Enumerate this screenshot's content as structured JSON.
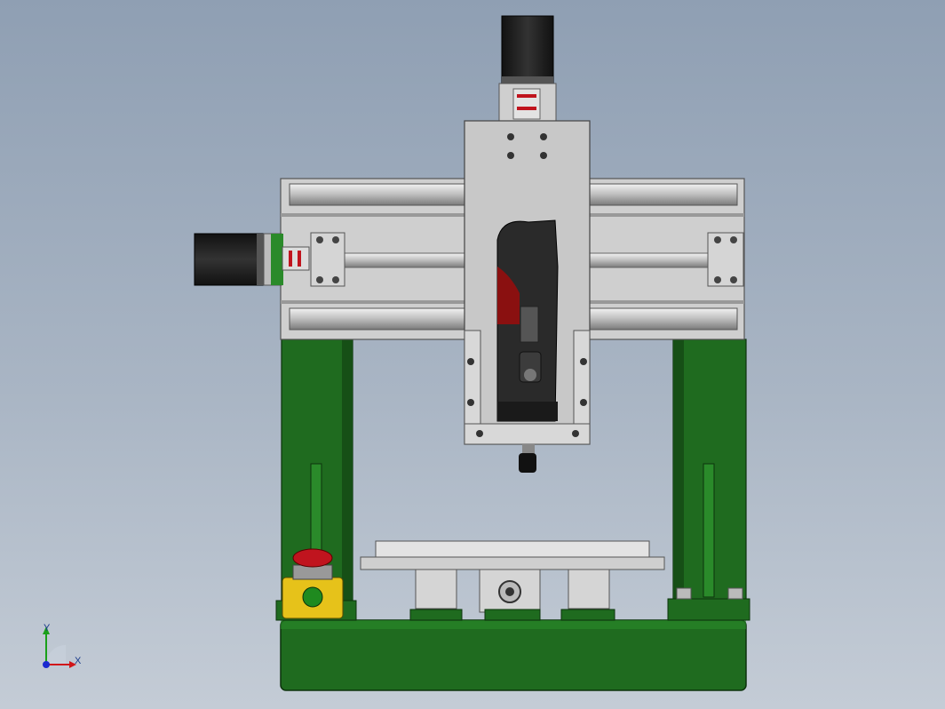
{
  "viewport": {
    "background_top": "#8f9fb3",
    "background_bottom": "#c4ccd6"
  },
  "model": {
    "frame_color": "#1f6b1f",
    "frame_dark": "#164f16",
    "aluminum_color": "#c9c9c9",
    "aluminum_dark": "#9a9a9a",
    "motor_color": "#1a1a1a",
    "spindle_accent": "#8a1010",
    "estop_yellow": "#e6c21a",
    "estop_red": "#c0141e"
  },
  "triad": {
    "x_label": "X",
    "y_label": "Y",
    "x_color": "#d0161a",
    "y_color": "#1aa01a",
    "z_color": "#1a2ad0"
  }
}
